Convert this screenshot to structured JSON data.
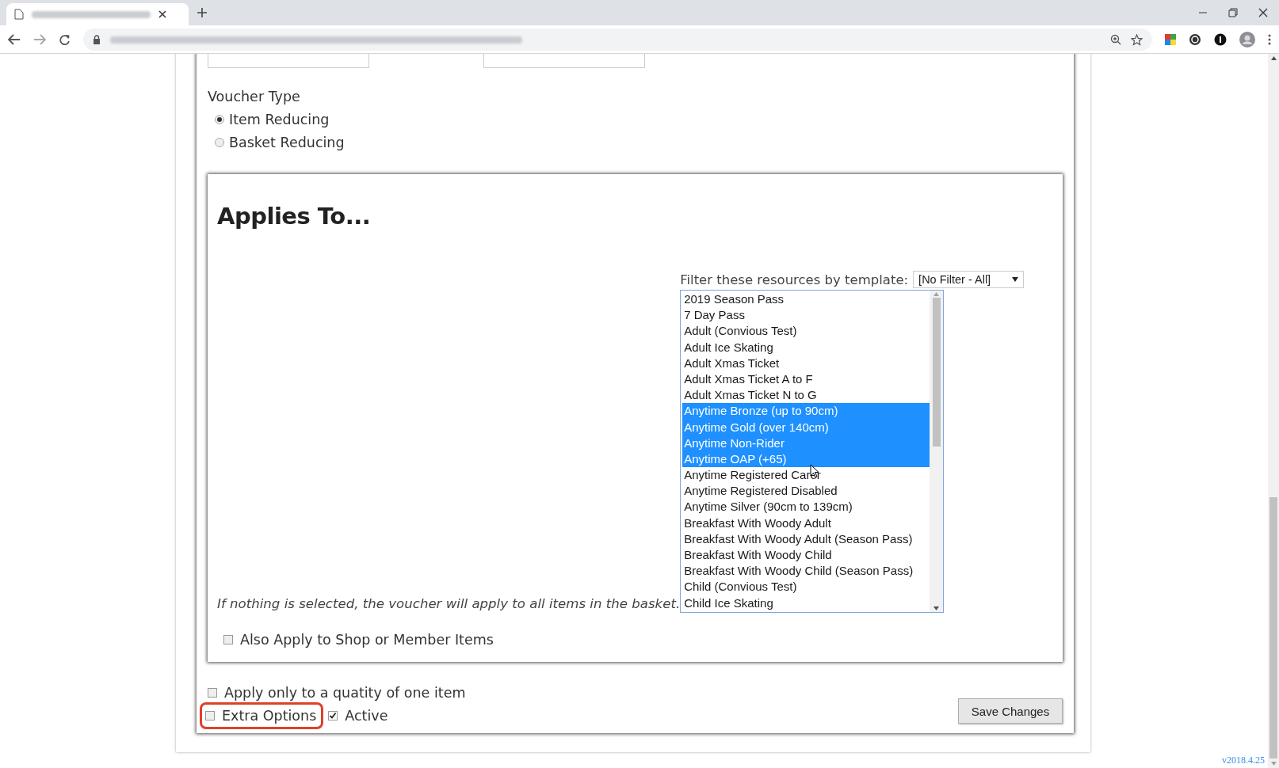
{
  "voucher_type": {
    "label": "Voucher Type",
    "options": [
      {
        "label": "Item Reducing",
        "selected": true
      },
      {
        "label": "Basket Reducing",
        "selected": false
      }
    ]
  },
  "applies_to": {
    "title": "Applies To...",
    "filter": {
      "label": "Filter these resources by template:",
      "value": "[No Filter - All]"
    },
    "resources": [
      {
        "label": "2019 Season Pass",
        "selected": false
      },
      {
        "label": "7 Day Pass",
        "selected": false
      },
      {
        "label": "Adult (Convious Test)",
        "selected": false
      },
      {
        "label": "Adult Ice Skating",
        "selected": false
      },
      {
        "label": "Adult Xmas Ticket",
        "selected": false
      },
      {
        "label": "Adult Xmas Ticket A to F",
        "selected": false
      },
      {
        "label": "Adult Xmas Ticket N to G",
        "selected": false
      },
      {
        "label": "Anytime Bronze (up to 90cm)",
        "selected": true
      },
      {
        "label": "Anytime Gold (over 140cm)",
        "selected": true
      },
      {
        "label": "Anytime Non-Rider",
        "selected": true
      },
      {
        "label": "Anytime OAP (+65)",
        "selected": true
      },
      {
        "label": "Anytime Registered Carer",
        "selected": false
      },
      {
        "label": "Anytime Registered Disabled",
        "selected": false
      },
      {
        "label": "Anytime Silver (90cm to 139cm)",
        "selected": false
      },
      {
        "label": "Breakfast With Woody Adult",
        "selected": false
      },
      {
        "label": "Breakfast With Woody Adult (Season Pass)",
        "selected": false
      },
      {
        "label": "Breakfast With Woody Child",
        "selected": false
      },
      {
        "label": "Breakfast With Woody Child (Season Pass)",
        "selected": false
      },
      {
        "label": "Child (Convious Test)",
        "selected": false
      },
      {
        "label": "Child Ice Skating",
        "selected": false
      }
    ],
    "note": "If nothing is selected, the voucher will apply to all items in the basket.",
    "shop_option": {
      "label": "Also Apply to Shop or Member Items",
      "checked": false
    }
  },
  "option_rows": [
    [
      {
        "label": "Apply only to a quatity of one item",
        "checked": false,
        "highlighted": false
      }
    ],
    [
      {
        "label": "Extra Options",
        "checked": false,
        "highlighted": true
      },
      {
        "label": "Active",
        "checked": true,
        "highlighted": false
      }
    ]
  ],
  "save_button": "Save Changes",
  "version": "v2018.4.25"
}
